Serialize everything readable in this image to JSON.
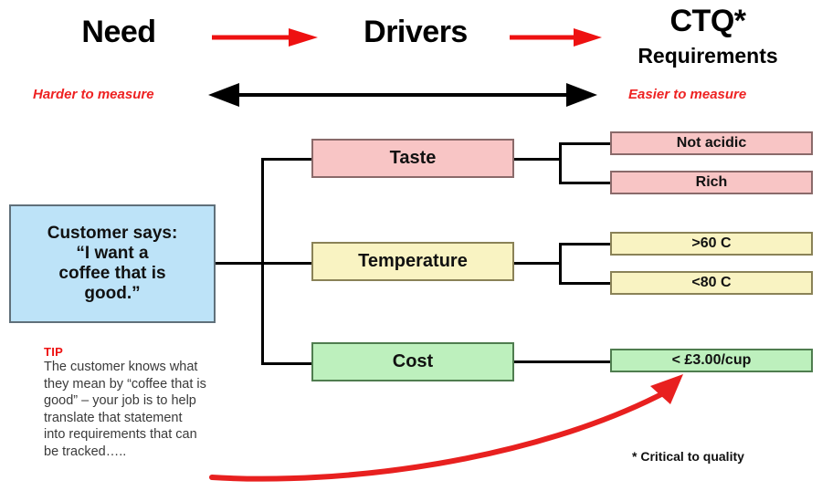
{
  "header": {
    "need_label": "Need",
    "drivers_label": "Drivers",
    "ctq_label": "CTQ*",
    "ctq_sub_label": "Requirements",
    "arrow1_icon": "right-arrow-icon",
    "arrow2_icon": "right-arrow-icon",
    "harder_label": "Harder to measure",
    "easier_label": "Easier to measure",
    "scale_arrow_icon": "double-headed-arrow-icon",
    "accent_red": "#ee2222"
  },
  "need": {
    "line1": "Customer says:",
    "line2": "“I want a",
    "line3": "coffee that is",
    "line4": "good.”",
    "fill": "#bde3f8",
    "border": "#60707a"
  },
  "drivers": [
    {
      "label": "Taste",
      "fill": "#f8c5c5",
      "color_name": "pink"
    },
    {
      "label": "Temperature",
      "fill": "#f9f3c2",
      "color_name": "yellow"
    },
    {
      "label": "Cost",
      "fill": "#bdf0bd",
      "color_name": "green"
    }
  ],
  "ctqs": [
    {
      "label": "Not acidic",
      "fill": "#f8c5c5",
      "color_name": "pink",
      "driver": "Taste"
    },
    {
      "label": "Rich",
      "fill": "#f8c5c5",
      "color_name": "pink",
      "driver": "Taste"
    },
    {
      "label": ">60 C",
      "fill": "#f9f3c2",
      "color_name": "yellow",
      "driver": "Temperature"
    },
    {
      "label": "<80 C",
      "fill": "#f9f3c2",
      "color_name": "yellow",
      "driver": "Temperature"
    },
    {
      "label": "< £3.00/cup",
      "fill": "#bdf0bd",
      "color_name": "green",
      "driver": "Cost"
    }
  ],
  "tip": {
    "heading": "TIP",
    "line1": "The customer knows what",
    "line2": "they mean by “coffee that is",
    "line3": "good” – your job is to help",
    "line4": "translate that statement",
    "line5": "into requirements that can",
    "line6": "be tracked…..",
    "heading_color": "#ee1111"
  },
  "footnote": {
    "text": "* Critical to quality",
    "callout_arrow_icon": "curved-red-arrow-icon",
    "callout_arrow_color": "#e8201f"
  }
}
